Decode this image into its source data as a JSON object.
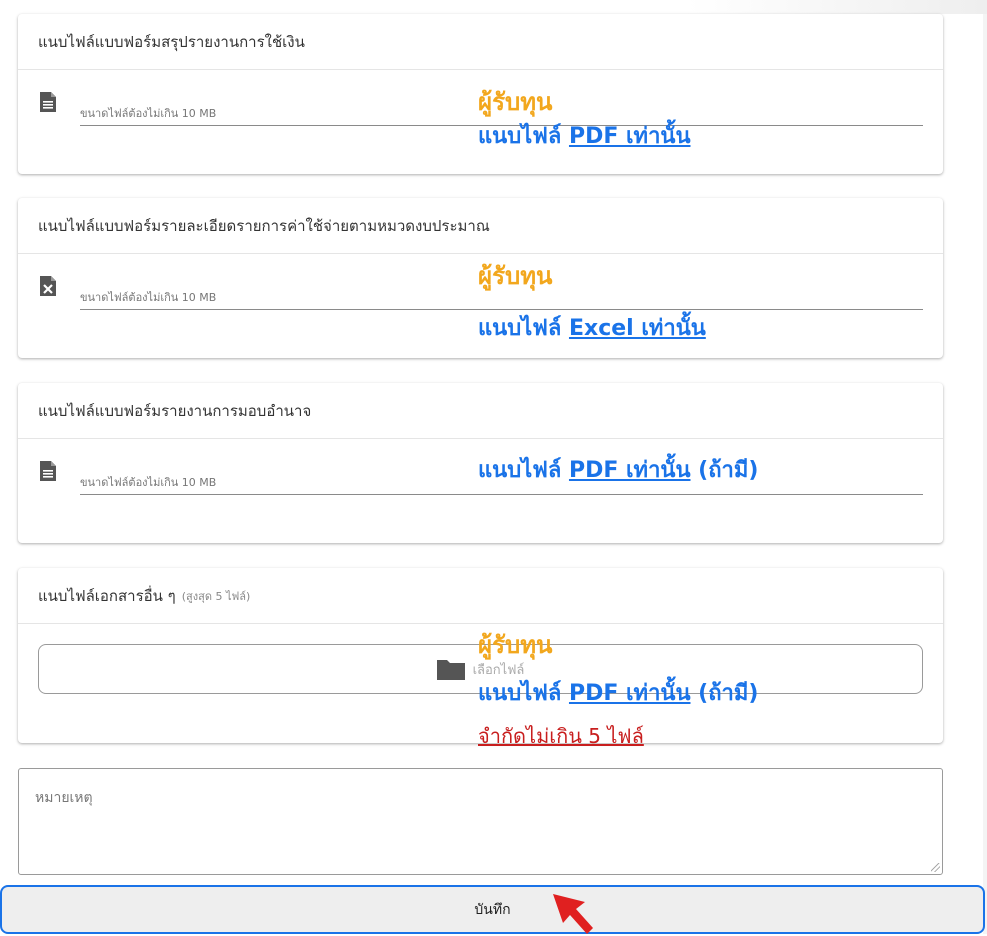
{
  "sections": [
    {
      "title": "แนบไฟล์แบบฟอร์มสรุปรายงานการใช้เงิน",
      "hint": "ขนาดไฟล์ต้องไม่เกิน 10 MB",
      "icon": "pdf-file-icon"
    },
    {
      "title": "แนบไฟล์แบบฟอร์มรายละเอียดรายการค่าใช้จ่ายตามหมวดงบประมาณ",
      "hint": "ขนาดไฟล์ต้องไม่เกิน 10 MB",
      "icon": "excel-file-icon"
    },
    {
      "title": "แนบไฟล์แบบฟอร์มรายงานการมอบอำนาจ",
      "hint": "ขนาดไฟล์ต้องไม่เกิน 10 MB",
      "icon": "pdf-file-icon"
    },
    {
      "title": "แนบไฟล์เอกสารอื่น ๆ",
      "title_small": "(สูงสุด 5 ไฟล์)",
      "button_label": "เลือกไฟล์",
      "icon": "folder-icon"
    }
  ],
  "annotations": {
    "a1_who": "ผู้รับทุน",
    "a1_prefix": "แนบไฟล์ ",
    "a1_link": "PDF เท่านั้น",
    "a2_who": "ผู้รับทุน",
    "a2_prefix": "แนบไฟล์ ",
    "a2_link": "Excel เท่านั้น",
    "a3_prefix": "แนบไฟล์ ",
    "a3_link": "PDF เท่านั้น",
    "a3_suffix": " (ถ้ามี)",
    "a4_who": "ผู้รับทุน",
    "a4_prefix": "แนบไฟล์ ",
    "a4_link": "PDF เท่านั้น",
    "a4_suffix": " (ถ้ามี)",
    "a4_limit": "จำกัดไม่เกิน 5 ไฟล์"
  },
  "remark": {
    "placeholder": "หมายเหตุ"
  },
  "save": {
    "label": "บันทึก"
  },
  "colors": {
    "accent": "#1a73e8",
    "annotation_orange": "#f2a71d",
    "annotation_red": "#c81e1e",
    "cursor_red": "#e02020"
  }
}
